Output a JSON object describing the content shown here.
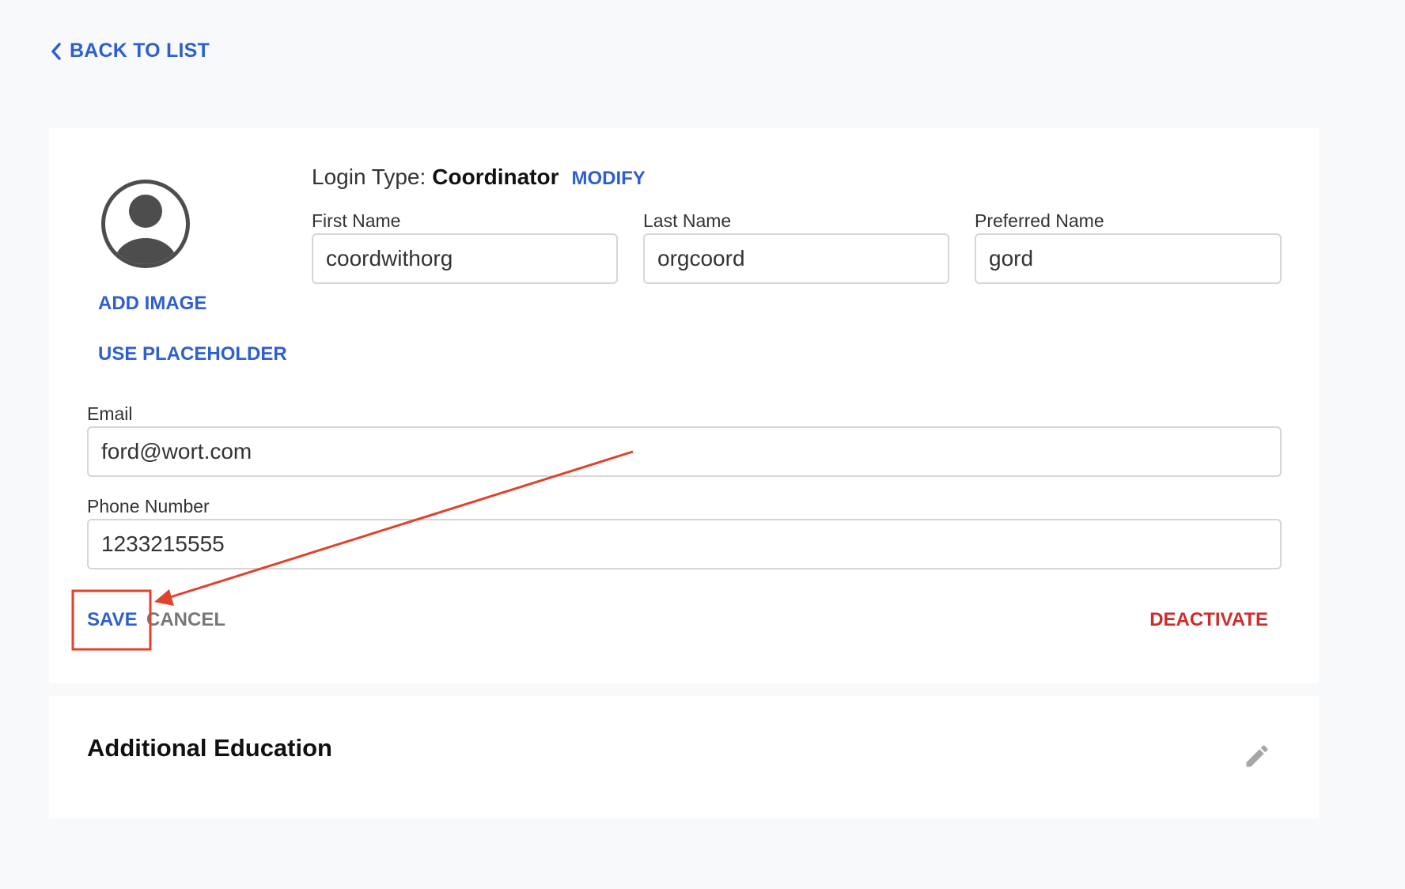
{
  "nav": {
    "back_label": "BACK TO LIST",
    "back_icon": "chevron-left-icon"
  },
  "profile": {
    "avatar_icon": "user-avatar-icon",
    "add_image_label": "ADD IMAGE",
    "use_placeholder_label": "USE PLACEHOLDER"
  },
  "login_type": {
    "label": "Login Type:",
    "value": "Coordinator",
    "modify_label": "MODIFY"
  },
  "fields": {
    "first_name": {
      "label": "First Name",
      "value": "coordwithorg"
    },
    "last_name": {
      "label": "Last Name",
      "value": "orgcoord"
    },
    "preferred_name": {
      "label": "Preferred Name",
      "value": "gord"
    },
    "email": {
      "label": "Email",
      "value": "ford@wort.com"
    },
    "phone": {
      "label": "Phone Number",
      "value": "1233215555"
    }
  },
  "actions": {
    "save_label": "SAVE",
    "cancel_label": "CANCEL",
    "deactivate_label": "DEACTIVATE"
  },
  "additional_education": {
    "title": "Additional Education",
    "edit_icon": "pencil-icon"
  },
  "colors": {
    "accent": "#2d5fd0",
    "danger": "#d02b2b",
    "annotation": "#e0422c",
    "background": "#f8f9fb"
  }
}
